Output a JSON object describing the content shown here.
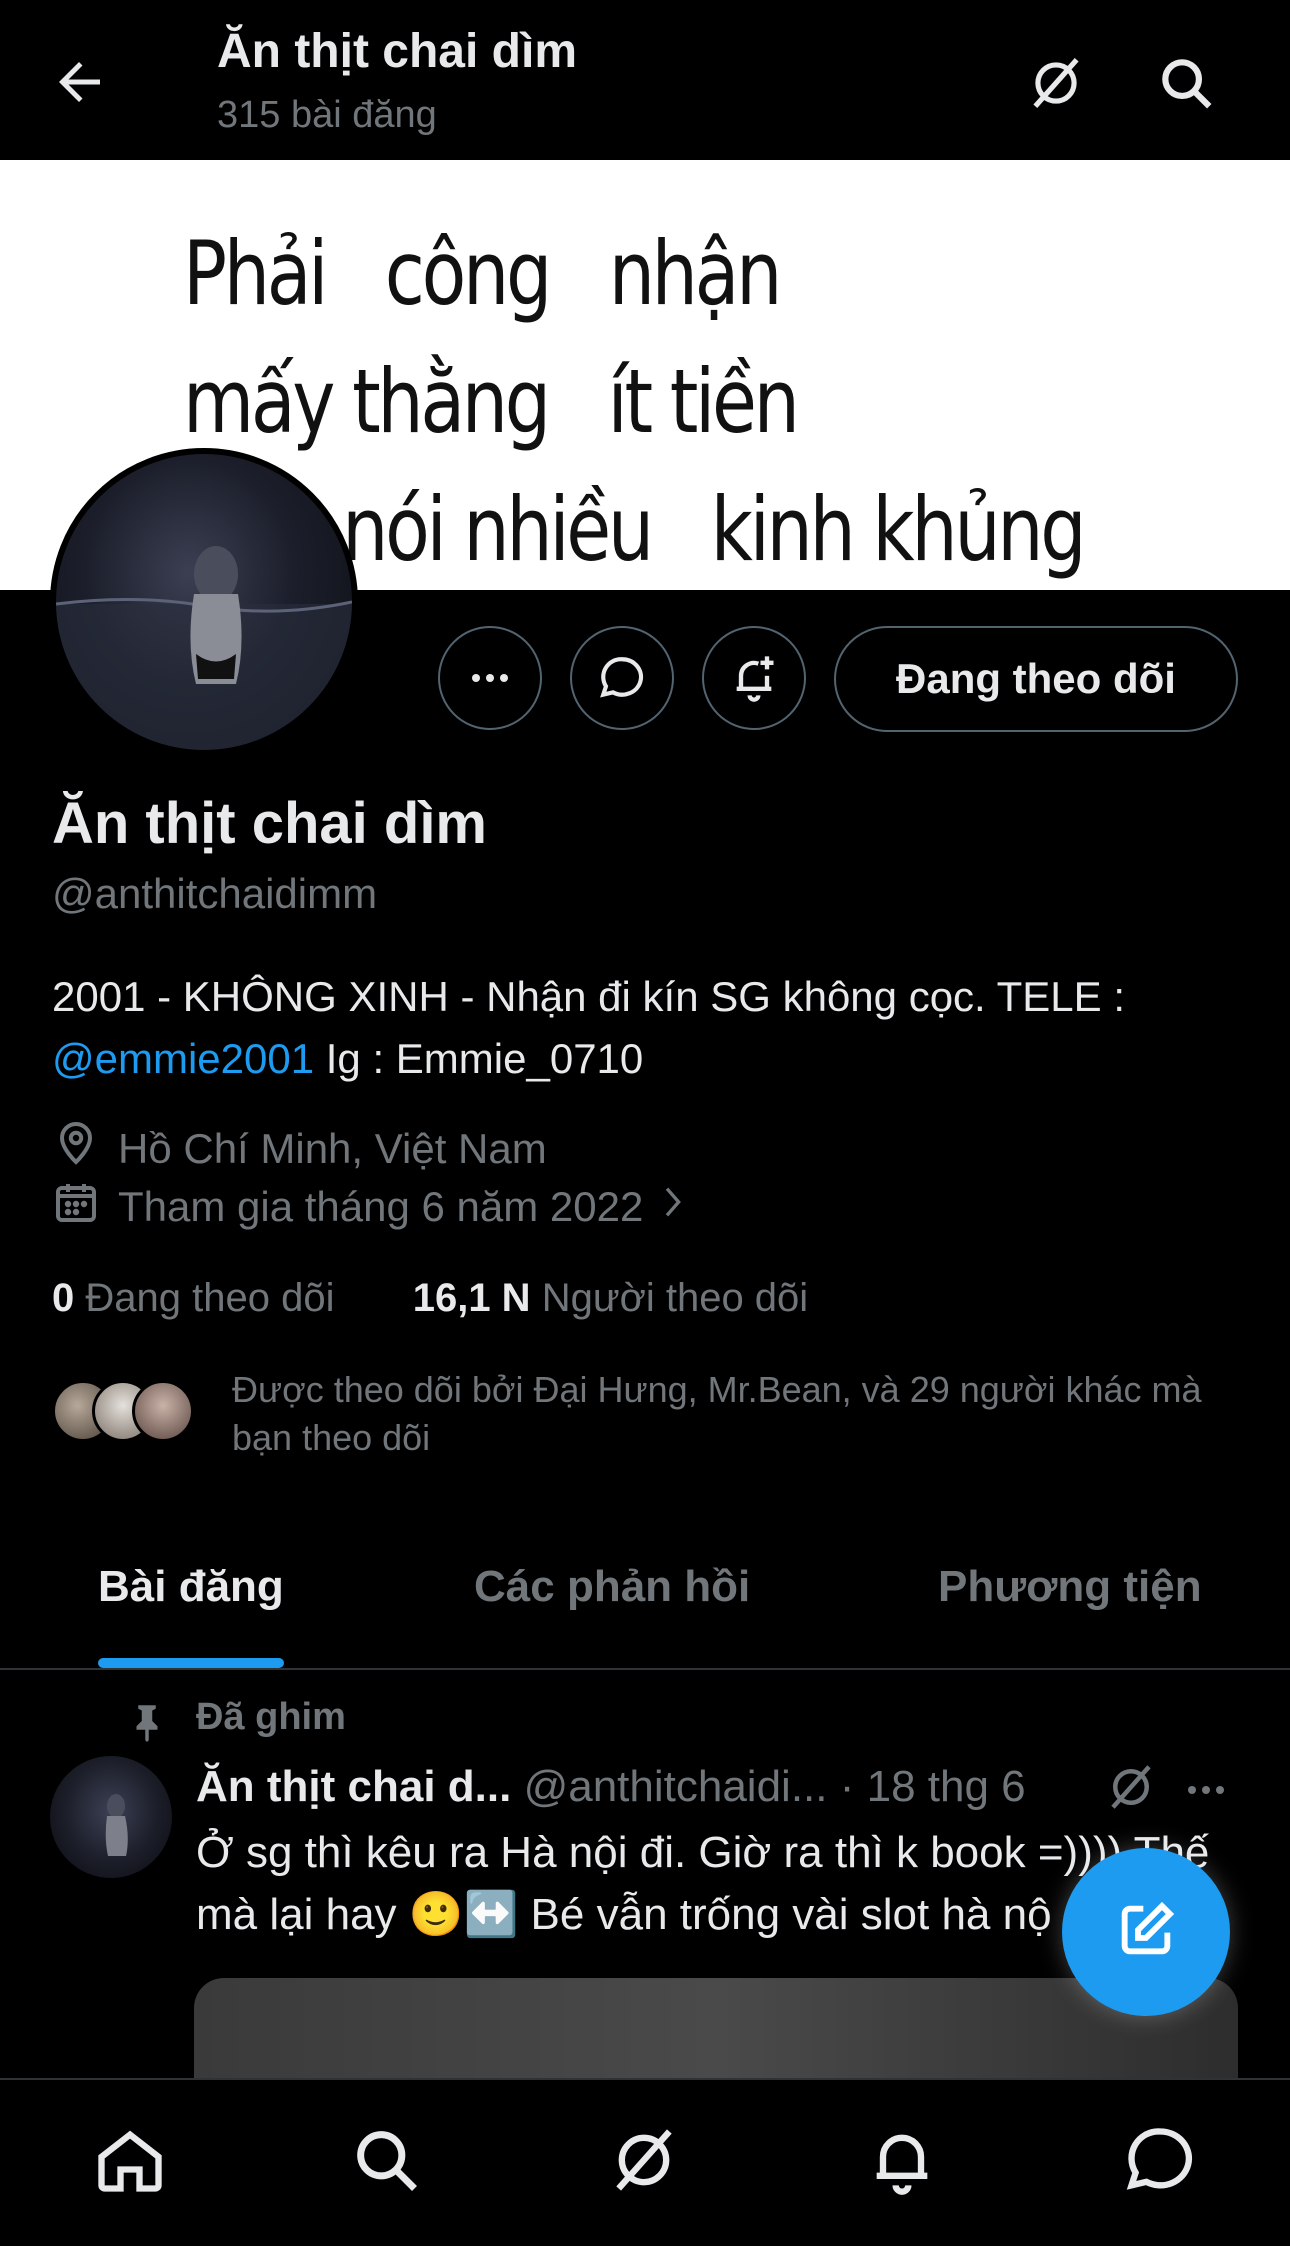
{
  "header": {
    "title": "Ăn thịt chai dìm",
    "post_count": "315 bài đăng"
  },
  "banner": {
    "text": "Phải   công   nhận\nmấy thằng   ít tiền\n        nói nhiều   kinh khủng"
  },
  "profile": {
    "name": "Ăn thịt chai dìm",
    "handle": "@anthitchaidimm",
    "bio_text": "2001 - KHÔNG XINH - Nhận đi kín SG không cọc. TELE :",
    "bio_link": "@emmie2001",
    "bio_tail": " Ig : Emmie_0710",
    "location": "Hồ Chí Minh, Việt Nam",
    "joined": "Tham gia tháng 6 năm 2022",
    "following_count": "0",
    "following_label": "Đang theo dõi",
    "followers_count": "16,1 N",
    "followers_label": "Người theo dõi",
    "followed_by": "Được theo dõi bởi Đại Hưng, Mr.Bean, và 29 người khác mà bạn theo dõi"
  },
  "actions": {
    "follow_label": "Đang theo dõi"
  },
  "tabs": [
    {
      "label": "Bài đăng",
      "active": true
    },
    {
      "label": "Các phản hồi",
      "active": false
    },
    {
      "label": "Phương tiện",
      "active": false
    }
  ],
  "post": {
    "pinned_label": "Đã ghim",
    "author_name": "Ăn thịt chai d...",
    "author_handle": "@anthitchaidi...",
    "time": "· 18 thg 6",
    "text_line1": "Ở sg thì kêu ra Hà nội đi. Giờ ra thì k book =)))) Thế",
    "text_line2": "mà lại hay 🙂↔️ Bé vẫn trống vài slot hà nộ"
  },
  "colors": {
    "accent": "#1d9bf0",
    "background": "#000000",
    "secondary_text": "#71767b",
    "border": "#536471"
  },
  "icons": {
    "top": [
      "back-arrow-icon",
      "grok-icon",
      "search-icon"
    ],
    "bottom_nav": [
      "home-icon",
      "search-icon",
      "grok-icon",
      "notifications-icon",
      "messages-icon"
    ]
  }
}
